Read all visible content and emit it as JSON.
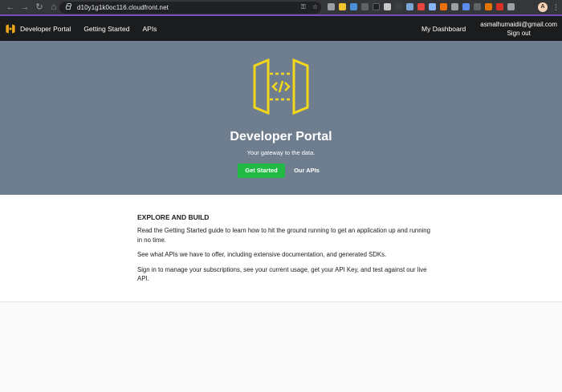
{
  "browser": {
    "url": "d10y1g1k0oc116.cloudfront.net",
    "profile_initial": "A",
    "icons": [
      "back-icon",
      "forward-icon",
      "reload-icon",
      "home-icon",
      "lock-icon",
      "key-icon",
      "star-icon",
      "extensions-icon",
      "menu-icon"
    ]
  },
  "nav": {
    "brand_label": "Developer Portal",
    "getting_started": "Getting Started",
    "apis": "APIs",
    "dashboard": "My Dashboard",
    "user_email": "asmalhumaidii@gmail.com",
    "sign_out": "Sign out"
  },
  "hero": {
    "title": "Developer Portal",
    "subtitle": "Your gateway to the data.",
    "primary_button": "Get Started",
    "secondary_button": "Our APIs",
    "background_color": "#6f7e8f",
    "logo_color": "#f2d61a"
  },
  "content": {
    "heading": "EXPLORE AND BUILD",
    "paragraphs": [
      "Read the Getting Started guide to learn how to hit the ground running to get an application up and running in no time.",
      "See what APIs we have to offer, including extensive documentation, and generated SDKs.",
      "Sign in to manage your subscriptions, see your current usage, get your API Key, and test against our live API."
    ]
  },
  "colors": {
    "nav_bg": "#1b1c1d",
    "primary_button": "#21ba45",
    "browser_accent": "#7a4fbf"
  }
}
